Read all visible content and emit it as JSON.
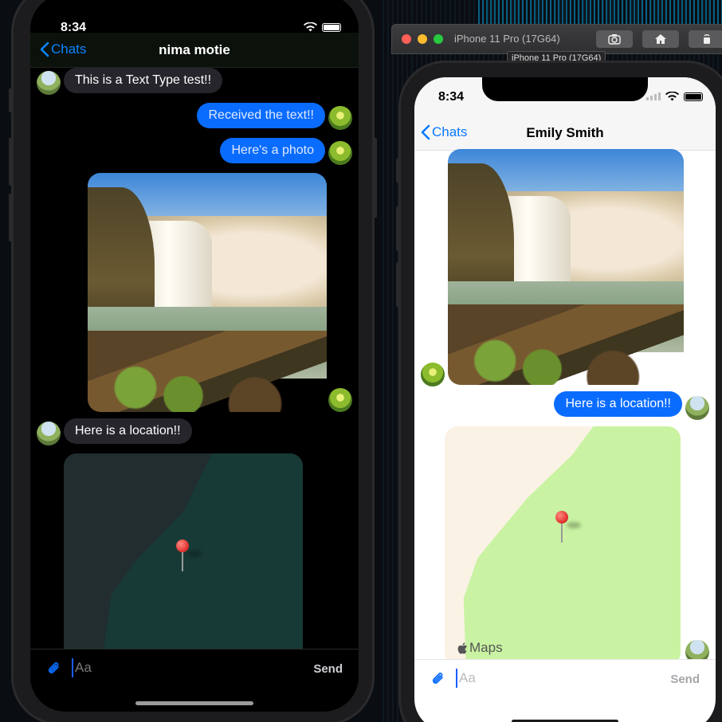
{
  "dark_phone": {
    "status_time": "8:34",
    "nav": {
      "back_label": "Chats",
      "title": "nima motie"
    },
    "messages": [
      {
        "text": "This is a Text Type test!!"
      },
      {
        "text": "Received the text!!"
      },
      {
        "text": "Here's a photo"
      },
      {
        "text": "Here is a location!!"
      }
    ],
    "input": {
      "placeholder": "Aa",
      "send_label": "Send"
    }
  },
  "simulator": {
    "title": "iPhone 11 Pro (17G64)",
    "tooltip": "iPhone 11 Pro (17G64)"
  },
  "light_phone": {
    "status_time": "8:34",
    "nav": {
      "back_label": "Chats",
      "title": "Emily Smith"
    },
    "messages": [
      {
        "text": "Here is a location!!"
      }
    ],
    "maps_label": "Maps",
    "input": {
      "placeholder": "Aa",
      "send_label": "Send"
    }
  },
  "colors": {
    "ios_blue": "#0a6cff",
    "dark_incoming_bubble": "#26252b",
    "map_dark_bg": "#212d2f",
    "map_dark_land": "#173a36",
    "map_light_bg": "#fbf2e6",
    "map_light_land": "#c9f3a2",
    "traffic_red": "#ff5f57",
    "traffic_yellow": "#febc2e",
    "traffic_green": "#28c840"
  }
}
